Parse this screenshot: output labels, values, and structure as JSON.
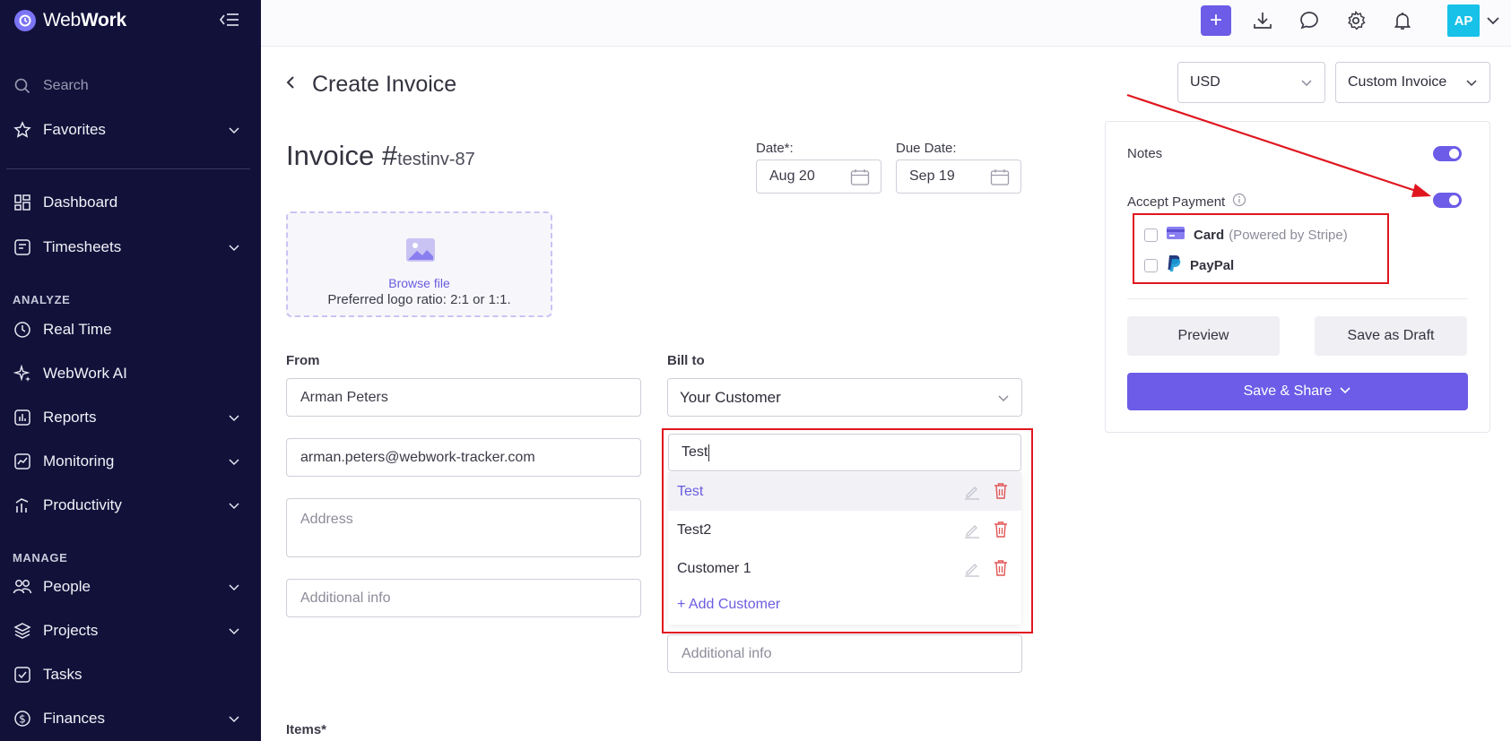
{
  "app": {
    "brand_part1": "Web",
    "brand_part2": "Work"
  },
  "sidebar": {
    "search_placeholder": "Search",
    "favorites": "Favorites",
    "dashboard": "Dashboard",
    "timesheets": "Timesheets",
    "section_analyze": "ANALYZE",
    "real_time": "Real Time",
    "webwork_ai": "WebWork AI",
    "reports": "Reports",
    "monitoring": "Monitoring",
    "productivity": "Productivity",
    "section_manage": "MANAGE",
    "people": "People",
    "projects": "Projects",
    "tasks": "Tasks",
    "finances": "Finances"
  },
  "topbar": {
    "add_label": "+",
    "avatar_initials": "AP"
  },
  "page": {
    "title": "Create Invoice"
  },
  "invoice": {
    "prefix": "Invoice #",
    "number": "testinv-87",
    "date_label": "Date*:",
    "date_value": "Aug 20",
    "due_label": "Due Date:",
    "due_value": "Sep 19",
    "browse_label": "Browse file",
    "logo_hint": "Preferred logo ratio: 2:1 or 1:1."
  },
  "from": {
    "label": "From",
    "name": "Arman Peters",
    "email": "arman.peters@webwork-tracker.com",
    "address_placeholder": "Address",
    "additional_placeholder": "Additional info"
  },
  "bill_to": {
    "label": "Bill to",
    "selected": "Your Customer",
    "search_value": "Test",
    "options": [
      {
        "name": "Test"
      },
      {
        "name": "Test2"
      },
      {
        "name": "Customer 1"
      }
    ],
    "add_label": "+ Add Customer",
    "additional_placeholder": "Additional info"
  },
  "items": {
    "label": "Items*"
  },
  "right_panel": {
    "currency": "USD",
    "template": "Custom Invoice",
    "notes_label": "Notes",
    "notes_enabled": true,
    "accept_label": "Accept Payment",
    "accept_enabled": true,
    "card_label": "Card",
    "card_sub": "(Powered by Stripe)",
    "paypal_label": "PayPal",
    "preview_label": "Preview",
    "draft_label": "Save as Draft",
    "share_label": "Save & Share"
  },
  "colors": {
    "accent": "#6c5ce7",
    "sidebar_bg": "#12113a",
    "highlight_red": "#e0161f"
  }
}
